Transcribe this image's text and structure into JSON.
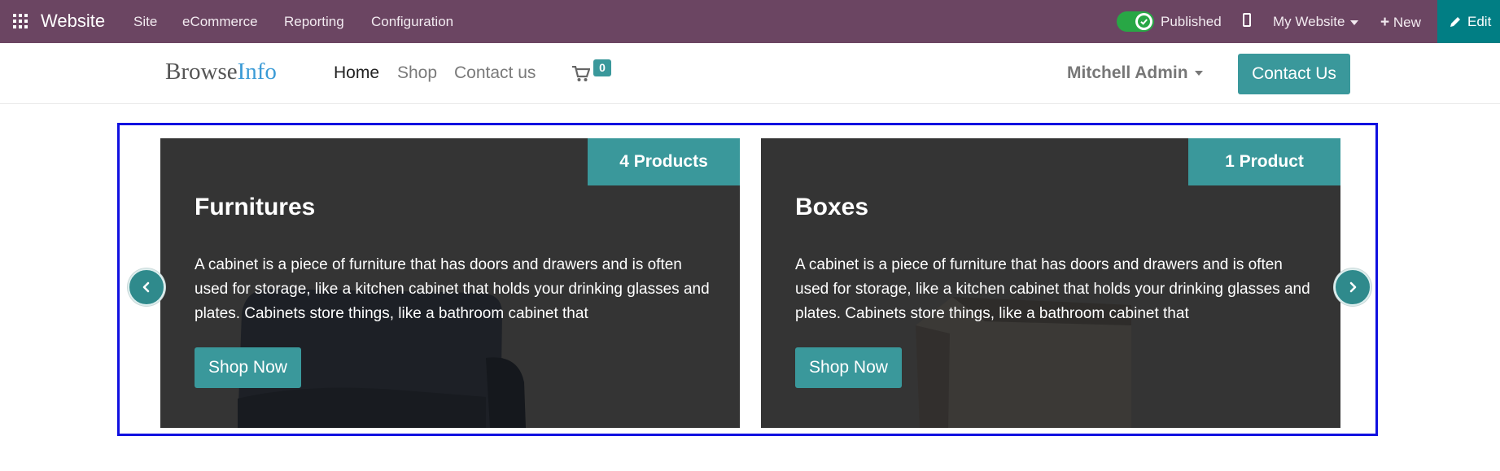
{
  "topbar": {
    "app_name": "Website",
    "menu": [
      "Site",
      "eCommerce",
      "Reporting",
      "Configuration"
    ],
    "published_label": "Published",
    "published": true,
    "website_selector": "My Website",
    "new_label": "New",
    "edit_label": "Edit"
  },
  "header": {
    "logo_part1": "Browse",
    "logo_part2": "Info",
    "nav": [
      "Home",
      "Shop",
      "Contact us"
    ],
    "active_nav": "Home",
    "cart_count": "0",
    "user_name": "Mitchell Admin",
    "contact_button": "Contact Us"
  },
  "carousel": {
    "cards": [
      {
        "badge": "4 Products",
        "title": "Furnitures",
        "description": "A cabinet is a piece of furniture that has doors and drawers and is often used for storage, like a kitchen cabinet that holds your drinking glasses and plates. Cabinets store things, like a bathroom cabinet that",
        "button": "Shop Now"
      },
      {
        "badge": "1 Product",
        "title": "Boxes",
        "description": "A cabinet is a piece of furniture that has doors and drawers and is often used for storage, like a kitchen cabinet that holds your drinking glasses and plates. Cabinets store things, like a bathroom cabinet that",
        "button": "Shop Now"
      }
    ]
  },
  "colors": {
    "topbar_bg": "#6b4562",
    "edit_bg": "#017e84",
    "accent": "#3a989b",
    "card_bg": "#333333",
    "selection_frame": "#1010e0"
  }
}
